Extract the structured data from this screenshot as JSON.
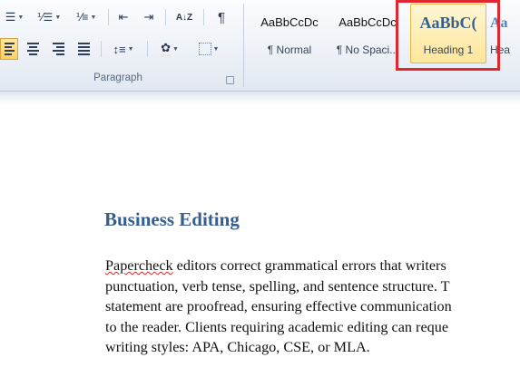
{
  "ribbon": {
    "paragraph": {
      "group_label": "Paragraph",
      "sort_glyph": "A↓Z",
      "pilcrow_glyph": "¶"
    },
    "styles": [
      {
        "preview": "AaBbCcDc",
        "name": "¶ Normal"
      },
      {
        "preview": "AaBbCcDc",
        "name": "¶ No Spaci..."
      },
      {
        "preview": "AaBbC(",
        "name": "Heading 1"
      },
      {
        "preview": "Aa",
        "name": "Hea"
      }
    ],
    "colors": {
      "highlight_box": "#e0262e",
      "heading_color": "#365f91"
    }
  },
  "document": {
    "heading": "Business Editing",
    "misspelled_word": "Papercheck",
    "body_lines": [
      " editors correct grammatical errors that writers",
      "punctuation, verb tense, spelling, and sentence structure. T",
      "statement are proofread, ensuring effective communication",
      "to the reader. Clients requiring academic editing can reque",
      "writing styles: APA, Chicago, CSE, or MLA."
    ]
  }
}
